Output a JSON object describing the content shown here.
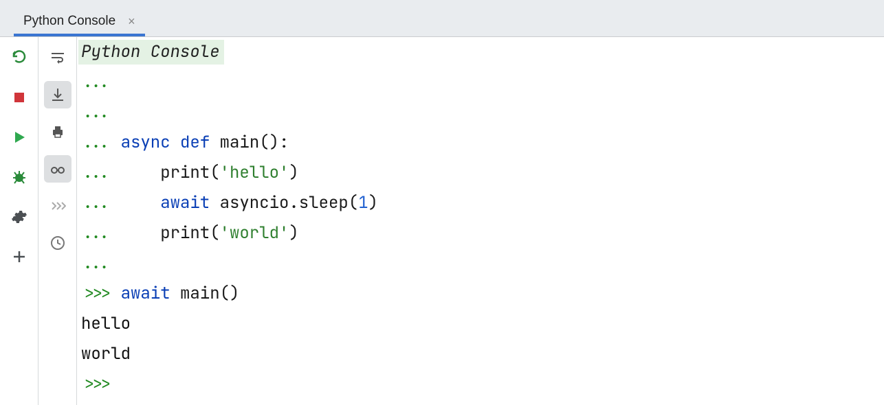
{
  "tab": {
    "label": "Python Console",
    "close_glyph": "×"
  },
  "toolbar_left": {
    "rerun": "Rerun",
    "stop": "Stop",
    "run": "Run",
    "debug": "Debug",
    "settings": "Settings",
    "add": "Add"
  },
  "toolbar_right": {
    "soft_wrap": "Soft-Wrap",
    "scroll_to_end": "Scroll to End",
    "print": "Print",
    "show_vars": "Show Variables",
    "command_queue": "Command Queue",
    "history": "History"
  },
  "console": {
    "title": "Python Console",
    "lines": [
      {
        "prompt": "...",
        "tokens": []
      },
      {
        "prompt": "...",
        "tokens": []
      },
      {
        "prompt": "...",
        "indent": " ",
        "tokens": [
          {
            "t": "async",
            "c": "kw"
          },
          {
            "t": " "
          },
          {
            "t": "def",
            "c": "kw"
          },
          {
            "t": " "
          },
          {
            "t": "main",
            "c": "fn"
          },
          {
            "t": "():"
          }
        ]
      },
      {
        "prompt": "...",
        "indent": "     ",
        "tokens": [
          {
            "t": "print("
          },
          {
            "t": "'hello'",
            "c": "str"
          },
          {
            "t": ")"
          }
        ]
      },
      {
        "prompt": "...",
        "indent": "     ",
        "tokens": [
          {
            "t": "await",
            "c": "kw"
          },
          {
            "t": " asyncio.sleep("
          },
          {
            "t": "1",
            "c": "num"
          },
          {
            "t": ")"
          }
        ]
      },
      {
        "prompt": "...",
        "indent": "     ",
        "tokens": [
          {
            "t": "print("
          },
          {
            "t": "'world'",
            "c": "str"
          },
          {
            "t": ")"
          }
        ]
      },
      {
        "prompt": "...",
        "tokens": []
      },
      {
        "prompt": ">>>",
        "indent": " ",
        "tokens": [
          {
            "t": "await",
            "c": "kw"
          },
          {
            "t": " main()"
          }
        ]
      },
      {
        "prompt": "",
        "tokens": [
          {
            "t": "hello",
            "c": "out"
          }
        ]
      },
      {
        "prompt": "",
        "tokens": [
          {
            "t": "world",
            "c": "out"
          }
        ]
      },
      {
        "prompt": ">>>",
        "indent": " ",
        "tokens": []
      }
    ]
  }
}
